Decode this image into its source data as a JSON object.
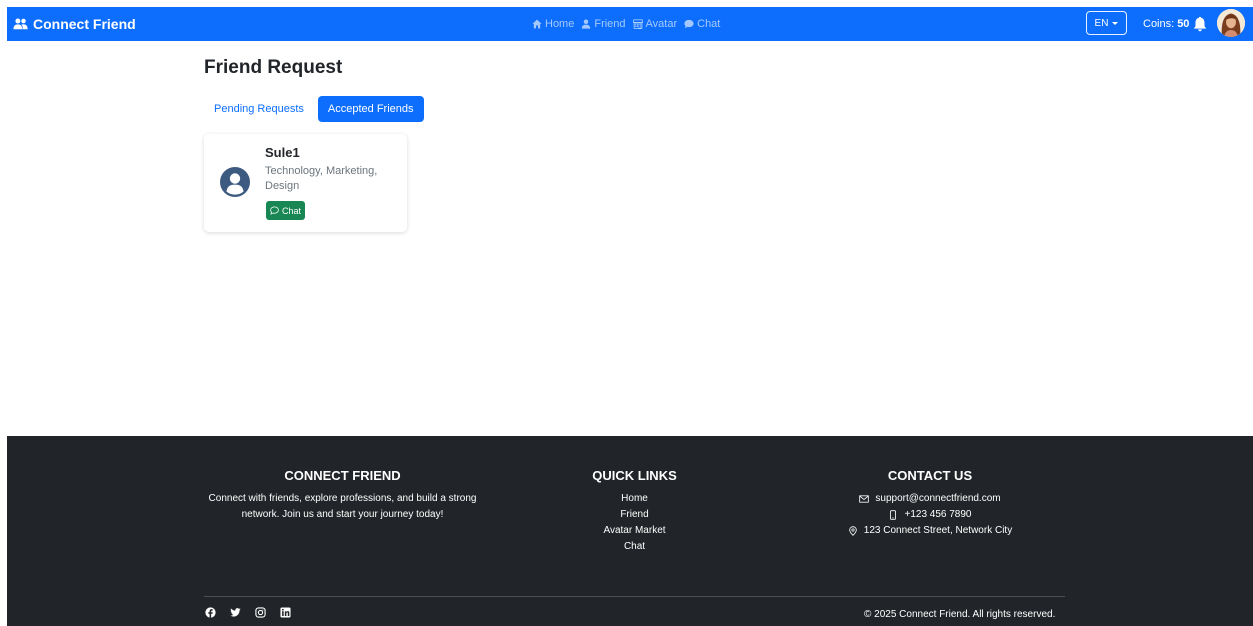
{
  "navbar": {
    "brand": "Connect Friend",
    "links": [
      {
        "label": "Home",
        "icon": "home-icon"
      },
      {
        "label": "Friend",
        "icon": "user-icon"
      },
      {
        "label": "Avatar",
        "icon": "store-icon"
      },
      {
        "label": "Chat",
        "icon": "chat-icon"
      }
    ],
    "language": "EN",
    "coins_label": "Coins:",
    "coins_value": "50"
  },
  "main": {
    "title": "Friend Request",
    "tabs": [
      {
        "label": "Pending Requests",
        "active": false
      },
      {
        "label": "Accepted Friends",
        "active": true
      }
    ],
    "friends": [
      {
        "name": "Sule1",
        "interests": "Technology, Marketing, Design",
        "chat_label": "Chat"
      }
    ]
  },
  "footer": {
    "about": {
      "heading": "CONNECT FRIEND",
      "text": "Connect with friends, explore professions, and build a strong network. Join us and start your journey today!"
    },
    "quick_links": {
      "heading": "QUICK LINKS",
      "links": [
        "Home",
        "Friend",
        "Avatar Market",
        "Chat"
      ]
    },
    "contact": {
      "heading": "CONTACT US",
      "email": "support@connectfriend.com",
      "phone": "+123 456 7890",
      "address": "123 Connect Street, Network City"
    },
    "socials": [
      "facebook-icon",
      "twitter-icon",
      "instagram-icon",
      "linkedin-icon"
    ],
    "copyright": "© 2025 Connect Friend. All rights reserved."
  },
  "colors": {
    "primary": "#0d6efd",
    "success": "#198754",
    "footer_bg": "#212529",
    "avatar_bg": "#3d5a80"
  }
}
